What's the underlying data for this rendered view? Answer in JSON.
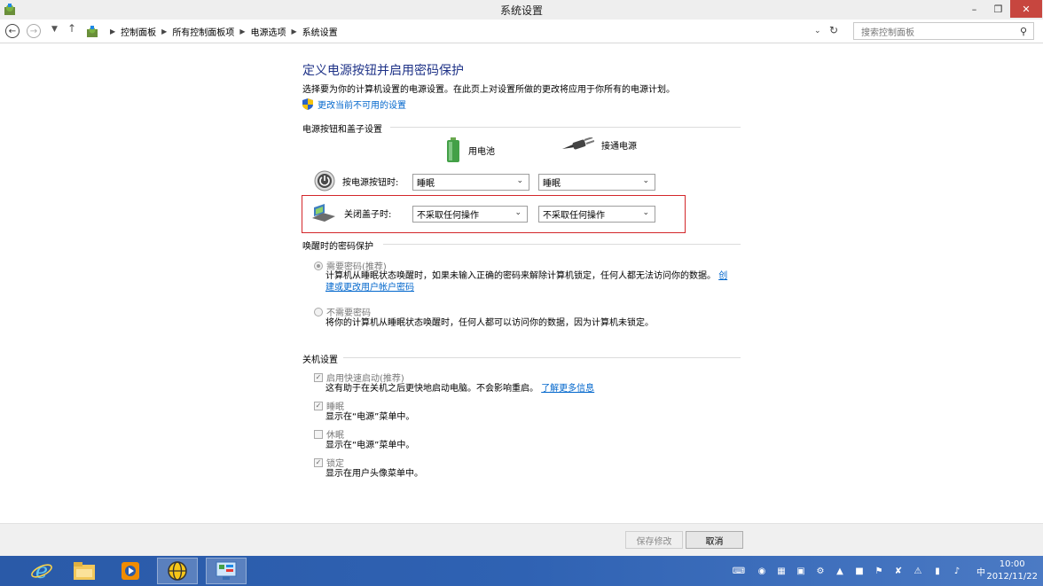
{
  "window": {
    "title": "系统设置"
  },
  "address": {
    "crumbs": [
      "控制面板",
      "所有控制面板项",
      "电源选项",
      "系统设置"
    ],
    "search_placeholder": "搜索控制面板"
  },
  "page": {
    "heading": "定义电源按钮并启用密码保护",
    "description": "选择要为你的计算机设置的电源设置。在此页上对设置所做的更改将应用于你所有的电源计划。",
    "change_link": "更改当前不可用的设置"
  },
  "power_section": {
    "label": "电源按钮和盖子设置",
    "battery_label": "用电池",
    "plugged_label": "接通电源",
    "rows": [
      {
        "label": "按电源按钮时:",
        "battery": "睡眠",
        "plugged": "睡眠"
      },
      {
        "label": "关闭盖子时:",
        "battery": "不采取任何操作",
        "plugged": "不采取任何操作"
      }
    ]
  },
  "password_section": {
    "label": "唤醒时的密码保护",
    "require": {
      "label": "需要密码(推荐)",
      "desc": "计算机从睡眠状态唤醒时，如果未输入正确的密码来解除计算机锁定，任何人都无法访问你的数据。",
      "link": "创建或更改用户帐户密码",
      "selected": true
    },
    "no_require": {
      "label": "不需要密码",
      "desc": "将你的计算机从睡眠状态唤醒时，任何人都可以访问你的数据，因为计算机未锁定。",
      "selected": false
    }
  },
  "shutdown_section": {
    "label": "关机设置",
    "items": [
      {
        "label": "启用快速启动(推荐)",
        "desc": "这有助于在关机之后更快地启动电脑。不会影响重启。",
        "link": "了解更多信息",
        "checked": true
      },
      {
        "label": "睡眠",
        "desc": "显示在“电源”菜单中。",
        "checked": true
      },
      {
        "label": "休眠",
        "desc": "显示在“电源”菜单中。",
        "checked": false
      },
      {
        "label": "锁定",
        "desc": "显示在用户头像菜单中。",
        "checked": true
      }
    ]
  },
  "buttons": {
    "save": "保存修改",
    "cancel": "取消"
  },
  "taskbar": {
    "clock_time": "10:00",
    "clock_date": "2012/11/22",
    "ime": "中"
  },
  "colors": {
    "heading": "#1e3287",
    "link": "#0066cc",
    "highlight_border": "#d3272b",
    "taskbar": "#2f62b3"
  },
  "icons": [
    "control-panel-icon",
    "shield-icon",
    "battery-icon",
    "plug-icon",
    "power-button-icon",
    "laptop-lid-icon",
    "ie-icon",
    "file-explorer-icon",
    "media-player-icon",
    "globe-icon",
    "control-panel-task-icon"
  ]
}
